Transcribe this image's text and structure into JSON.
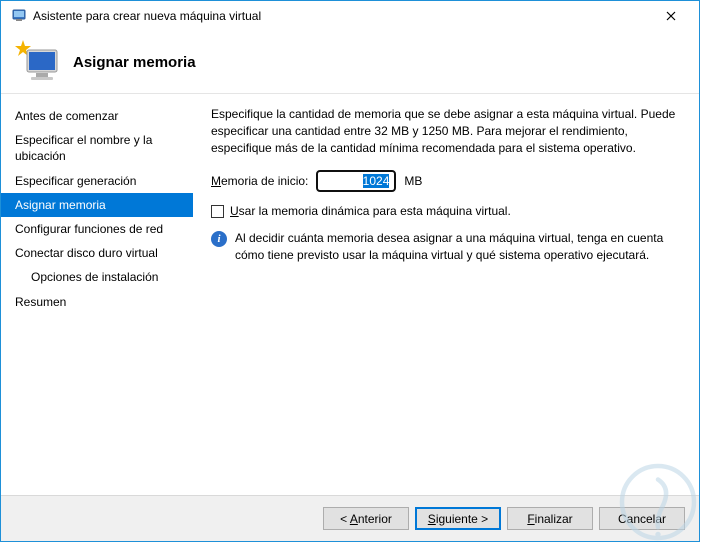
{
  "window": {
    "title": "Asistente para crear nueva máquina virtual"
  },
  "header": {
    "title": "Asignar memoria"
  },
  "sidebar": {
    "items": [
      {
        "label": "Antes de comenzar",
        "active": false
      },
      {
        "label": "Especificar el nombre y la ubicación",
        "active": false
      },
      {
        "label": "Especificar generación",
        "active": false
      },
      {
        "label": "Asignar memoria",
        "active": true
      },
      {
        "label": "Configurar funciones de red",
        "active": false
      },
      {
        "label": "Conectar disco duro virtual",
        "active": false
      },
      {
        "label": "Opciones de instalación",
        "active": false,
        "sub": true
      },
      {
        "label": "Resumen",
        "active": false
      }
    ]
  },
  "content": {
    "description": "Especifique la cantidad de memoria que se debe asignar a esta máquina virtual. Puede especificar una cantidad entre 32 MB y 1250 MB. Para mejorar el rendimiento, especifique más de la cantidad mínima recomendada para el sistema operativo.",
    "memory_label_pre": "M",
    "memory_label_post": "emoria de inicio:",
    "memory_value": "1024",
    "memory_unit": "MB",
    "dynamic_check_pre": "U",
    "dynamic_check_post": "sar la memoria dinámica para esta máquina virtual.",
    "info_text": "Al decidir cuánta memoria desea asignar a una máquina virtual, tenga en cuenta cómo tiene previsto usar la máquina virtual y qué sistema operativo ejecutará."
  },
  "footer": {
    "previous_pre": "< ",
    "previous_mn": "A",
    "previous_post": "nterior",
    "next_mn": "S",
    "next_post": "iguiente >",
    "finish_mn": "F",
    "finish_post": "inalizar",
    "cancel_label": "Cancelar"
  }
}
